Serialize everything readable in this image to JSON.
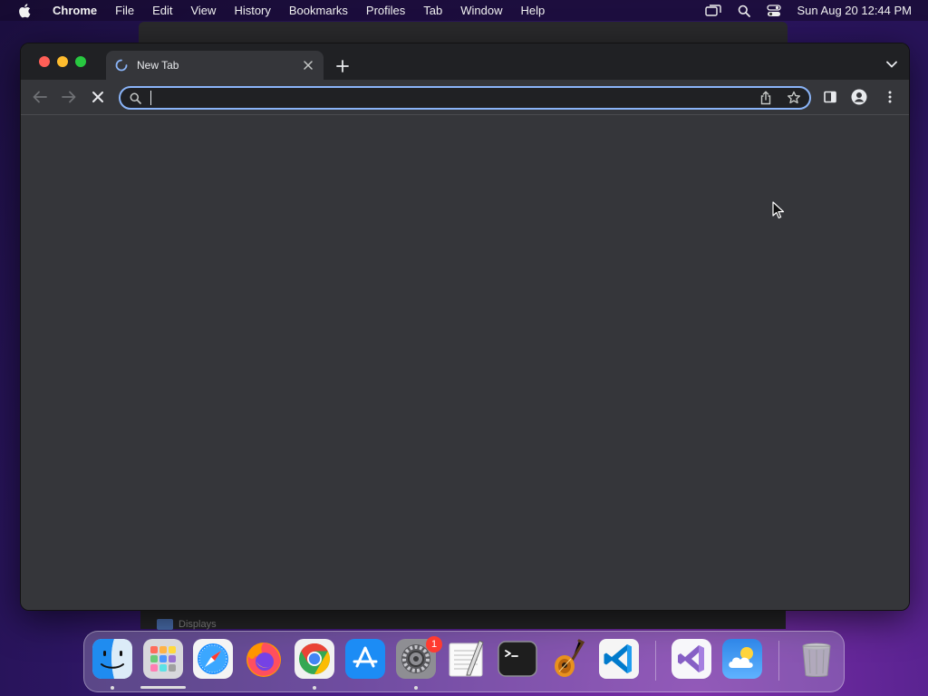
{
  "menubar": {
    "app_name": "Chrome",
    "items": [
      "File",
      "Edit",
      "View",
      "History",
      "Bookmarks",
      "Profiles",
      "Tab",
      "Window",
      "Help"
    ],
    "clock": "Sun Aug 20  12:44 PM"
  },
  "background_window": {
    "label": "Displays"
  },
  "browser": {
    "tab": {
      "title": "New Tab",
      "state": "loading"
    },
    "omnibox": {
      "value": "",
      "placeholder": ""
    }
  },
  "dock": {
    "apps": [
      "finder-icon",
      "launchpad-icon",
      "safari-icon",
      "firefox-icon",
      "chrome-icon",
      "app-store-icon",
      "system-settings-icon",
      "textedit-icon",
      "terminal-icon",
      "garageband-icon",
      "vscode-icon",
      "visual-studio-icon",
      "weather-icon",
      "trash-icon"
    ],
    "system_settings_badge": "1"
  },
  "colors": {
    "tabstrip": "#202124",
    "toolbar": "#35363a",
    "omnibox_focus": "#8ab4f8",
    "close_red": "#ff5f57",
    "min_yellow": "#febc2e",
    "max_green": "#28c840"
  }
}
